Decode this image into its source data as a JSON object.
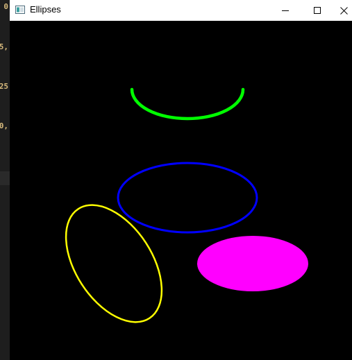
{
  "window": {
    "title": "Ellipses",
    "icon": "app-window-icon",
    "buttons": [
      "minimize-icon",
      "maximize-icon",
      "close-icon"
    ]
  },
  "editor_fragments": [
    "0",
    "5,",
    "25",
    "0,"
  ],
  "canvas": {
    "background": "#000000",
    "shapes": [
      {
        "kind": "arc",
        "color": "#00ff00",
        "filled": false
      },
      {
        "kind": "ellipse",
        "color": "#0000ff",
        "filled": false
      },
      {
        "kind": "ellipse-rotated",
        "color": "#ffff00",
        "filled": false
      },
      {
        "kind": "ellipse",
        "color": "#ff00ff",
        "filled": true
      }
    ]
  }
}
